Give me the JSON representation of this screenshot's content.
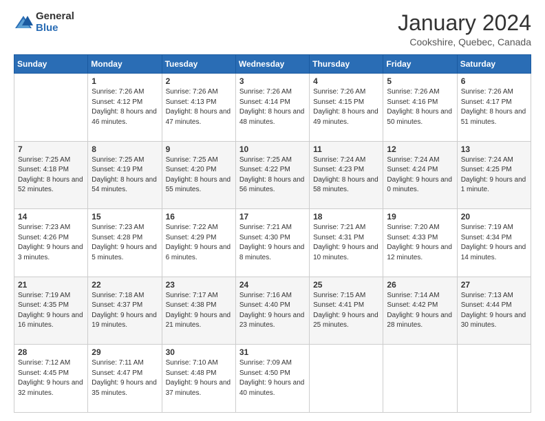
{
  "logo": {
    "general": "General",
    "blue": "Blue"
  },
  "header": {
    "month": "January 2024",
    "location": "Cookshire, Quebec, Canada"
  },
  "weekdays": [
    "Sunday",
    "Monday",
    "Tuesday",
    "Wednesday",
    "Thursday",
    "Friday",
    "Saturday"
  ],
  "weeks": [
    [
      {
        "day": "",
        "sunrise": "",
        "sunset": "",
        "daylight": ""
      },
      {
        "day": "1",
        "sunrise": "Sunrise: 7:26 AM",
        "sunset": "Sunset: 4:12 PM",
        "daylight": "Daylight: 8 hours and 46 minutes."
      },
      {
        "day": "2",
        "sunrise": "Sunrise: 7:26 AM",
        "sunset": "Sunset: 4:13 PM",
        "daylight": "Daylight: 8 hours and 47 minutes."
      },
      {
        "day": "3",
        "sunrise": "Sunrise: 7:26 AM",
        "sunset": "Sunset: 4:14 PM",
        "daylight": "Daylight: 8 hours and 48 minutes."
      },
      {
        "day": "4",
        "sunrise": "Sunrise: 7:26 AM",
        "sunset": "Sunset: 4:15 PM",
        "daylight": "Daylight: 8 hours and 49 minutes."
      },
      {
        "day": "5",
        "sunrise": "Sunrise: 7:26 AM",
        "sunset": "Sunset: 4:16 PM",
        "daylight": "Daylight: 8 hours and 50 minutes."
      },
      {
        "day": "6",
        "sunrise": "Sunrise: 7:26 AM",
        "sunset": "Sunset: 4:17 PM",
        "daylight": "Daylight: 8 hours and 51 minutes."
      }
    ],
    [
      {
        "day": "7",
        "sunrise": "Sunrise: 7:25 AM",
        "sunset": "Sunset: 4:18 PM",
        "daylight": "Daylight: 8 hours and 52 minutes."
      },
      {
        "day": "8",
        "sunrise": "Sunrise: 7:25 AM",
        "sunset": "Sunset: 4:19 PM",
        "daylight": "Daylight: 8 hours and 54 minutes."
      },
      {
        "day": "9",
        "sunrise": "Sunrise: 7:25 AM",
        "sunset": "Sunset: 4:20 PM",
        "daylight": "Daylight: 8 hours and 55 minutes."
      },
      {
        "day": "10",
        "sunrise": "Sunrise: 7:25 AM",
        "sunset": "Sunset: 4:22 PM",
        "daylight": "Daylight: 8 hours and 56 minutes."
      },
      {
        "day": "11",
        "sunrise": "Sunrise: 7:24 AM",
        "sunset": "Sunset: 4:23 PM",
        "daylight": "Daylight: 8 hours and 58 minutes."
      },
      {
        "day": "12",
        "sunrise": "Sunrise: 7:24 AM",
        "sunset": "Sunset: 4:24 PM",
        "daylight": "Daylight: 9 hours and 0 minutes."
      },
      {
        "day": "13",
        "sunrise": "Sunrise: 7:24 AM",
        "sunset": "Sunset: 4:25 PM",
        "daylight": "Daylight: 9 hours and 1 minute."
      }
    ],
    [
      {
        "day": "14",
        "sunrise": "Sunrise: 7:23 AM",
        "sunset": "Sunset: 4:26 PM",
        "daylight": "Daylight: 9 hours and 3 minutes."
      },
      {
        "day": "15",
        "sunrise": "Sunrise: 7:23 AM",
        "sunset": "Sunset: 4:28 PM",
        "daylight": "Daylight: 9 hours and 5 minutes."
      },
      {
        "day": "16",
        "sunrise": "Sunrise: 7:22 AM",
        "sunset": "Sunset: 4:29 PM",
        "daylight": "Daylight: 9 hours and 6 minutes."
      },
      {
        "day": "17",
        "sunrise": "Sunrise: 7:21 AM",
        "sunset": "Sunset: 4:30 PM",
        "daylight": "Daylight: 9 hours and 8 minutes."
      },
      {
        "day": "18",
        "sunrise": "Sunrise: 7:21 AM",
        "sunset": "Sunset: 4:31 PM",
        "daylight": "Daylight: 9 hours and 10 minutes."
      },
      {
        "day": "19",
        "sunrise": "Sunrise: 7:20 AM",
        "sunset": "Sunset: 4:33 PM",
        "daylight": "Daylight: 9 hours and 12 minutes."
      },
      {
        "day": "20",
        "sunrise": "Sunrise: 7:19 AM",
        "sunset": "Sunset: 4:34 PM",
        "daylight": "Daylight: 9 hours and 14 minutes."
      }
    ],
    [
      {
        "day": "21",
        "sunrise": "Sunrise: 7:19 AM",
        "sunset": "Sunset: 4:35 PM",
        "daylight": "Daylight: 9 hours and 16 minutes."
      },
      {
        "day": "22",
        "sunrise": "Sunrise: 7:18 AM",
        "sunset": "Sunset: 4:37 PM",
        "daylight": "Daylight: 9 hours and 19 minutes."
      },
      {
        "day": "23",
        "sunrise": "Sunrise: 7:17 AM",
        "sunset": "Sunset: 4:38 PM",
        "daylight": "Daylight: 9 hours and 21 minutes."
      },
      {
        "day": "24",
        "sunrise": "Sunrise: 7:16 AM",
        "sunset": "Sunset: 4:40 PM",
        "daylight": "Daylight: 9 hours and 23 minutes."
      },
      {
        "day": "25",
        "sunrise": "Sunrise: 7:15 AM",
        "sunset": "Sunset: 4:41 PM",
        "daylight": "Daylight: 9 hours and 25 minutes."
      },
      {
        "day": "26",
        "sunrise": "Sunrise: 7:14 AM",
        "sunset": "Sunset: 4:42 PM",
        "daylight": "Daylight: 9 hours and 28 minutes."
      },
      {
        "day": "27",
        "sunrise": "Sunrise: 7:13 AM",
        "sunset": "Sunset: 4:44 PM",
        "daylight": "Daylight: 9 hours and 30 minutes."
      }
    ],
    [
      {
        "day": "28",
        "sunrise": "Sunrise: 7:12 AM",
        "sunset": "Sunset: 4:45 PM",
        "daylight": "Daylight: 9 hours and 32 minutes."
      },
      {
        "day": "29",
        "sunrise": "Sunrise: 7:11 AM",
        "sunset": "Sunset: 4:47 PM",
        "daylight": "Daylight: 9 hours and 35 minutes."
      },
      {
        "day": "30",
        "sunrise": "Sunrise: 7:10 AM",
        "sunset": "Sunset: 4:48 PM",
        "daylight": "Daylight: 9 hours and 37 minutes."
      },
      {
        "day": "31",
        "sunrise": "Sunrise: 7:09 AM",
        "sunset": "Sunset: 4:50 PM",
        "daylight": "Daylight: 9 hours and 40 minutes."
      },
      {
        "day": "",
        "sunrise": "",
        "sunset": "",
        "daylight": ""
      },
      {
        "day": "",
        "sunrise": "",
        "sunset": "",
        "daylight": ""
      },
      {
        "day": "",
        "sunrise": "",
        "sunset": "",
        "daylight": ""
      }
    ]
  ]
}
